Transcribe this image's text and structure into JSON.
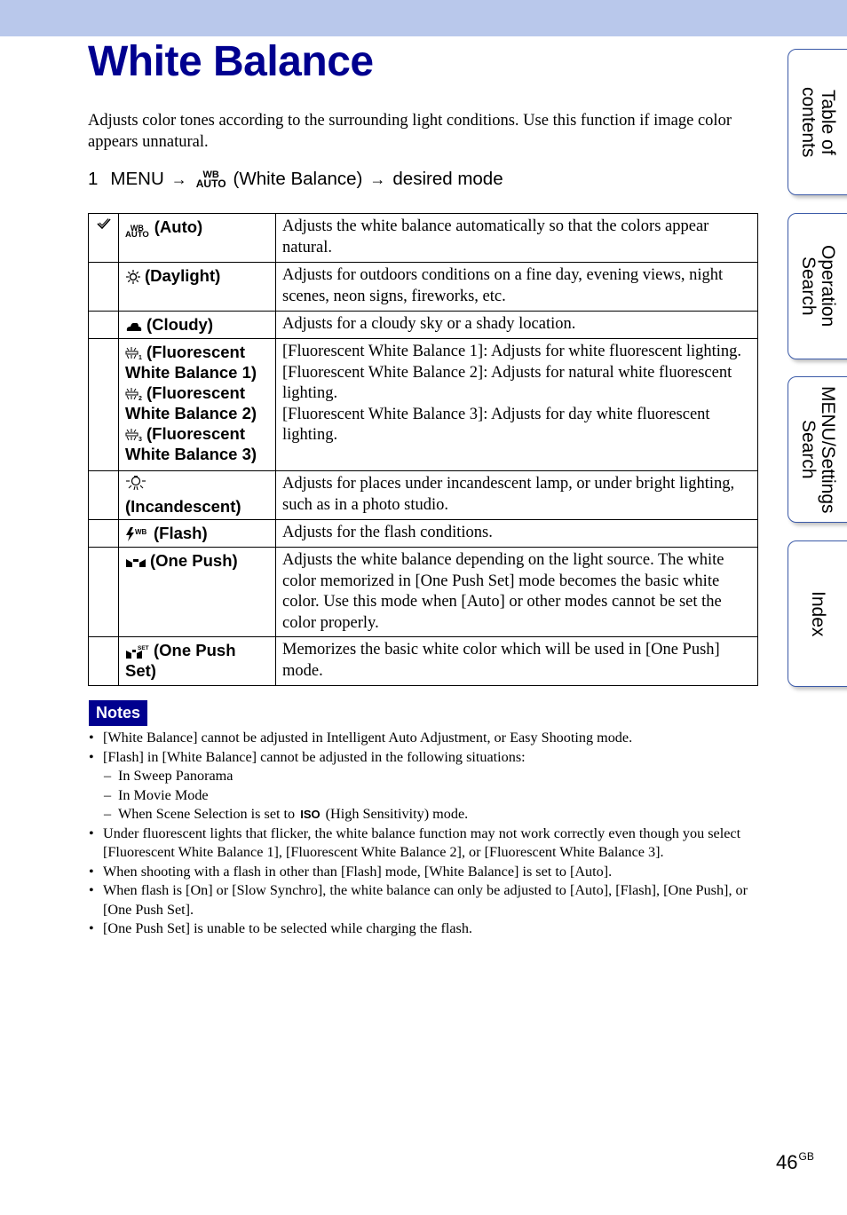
{
  "page": {
    "title": "White Balance",
    "intro": "Adjusts color tones according to the surrounding light conditions. Use this function if image color appears unnatural.",
    "step": {
      "number": "1",
      "menu": "MENU",
      "arrow": "→",
      "icon_top": "WB",
      "icon_bottom": "AUTO",
      "target": "(White Balance)",
      "result": "desired mode"
    }
  },
  "modes": [
    {
      "default": true,
      "check_icon": "✓",
      "icon": "wb-auto",
      "icon_text_top": "WB",
      "icon_text_bottom": "AUTO",
      "label": "(Auto)",
      "description": [
        "Adjusts the white balance automatically so that the colors appear natural."
      ]
    },
    {
      "default": false,
      "icon": "daylight",
      "icon_glyph": "☀",
      "label": "(Daylight)",
      "description": [
        "Adjusts for outdoors conditions on a fine day, evening views, night scenes, neon signs, fireworks, etc."
      ]
    },
    {
      "default": false,
      "icon": "cloudy",
      "icon_glyph": "☁",
      "label": "(Cloudy)",
      "description": [
        "Adjusts for a cloudy sky or a shady location."
      ]
    },
    {
      "default": false,
      "icon": "fluorescent",
      "labels": [
        {
          "icon_glyph": "▤₁",
          "label": "(Fluorescent White Balance 1)"
        },
        {
          "icon_glyph": "▤₂",
          "label": "(Fluorescent White Balance 2)"
        },
        {
          "icon_glyph": "▤₃",
          "label": "(Fluorescent White Balance 3)"
        }
      ],
      "description": [
        "[Fluorescent White Balance 1]: Adjusts for white fluorescent lighting.",
        "[Fluorescent White Balance 2]: Adjusts for natural white fluorescent lighting.",
        "[Fluorescent White Balance 3]: Adjusts for day white fluorescent lighting."
      ]
    },
    {
      "default": false,
      "icon": "incandescent",
      "icon_glyph": "💡",
      "label": "(Incandescent)",
      "description": [
        "Adjusts for places under incandescent lamp, or under bright lighting, such as in a photo studio."
      ]
    },
    {
      "default": false,
      "icon": "flash-wb",
      "icon_glyph": "ϟᵂᴮ",
      "label": "(Flash)",
      "description": [
        "Adjusts for the flash conditions."
      ]
    },
    {
      "default": false,
      "icon": "one-push",
      "icon_glyph": "⬙",
      "label": "(One Push)",
      "description": [
        "Adjusts the white balance depending on the light source. The white color memorized in [One Push Set] mode becomes the basic white color. Use this mode when [Auto] or other modes cannot be set the color properly."
      ]
    },
    {
      "default": false,
      "icon": "one-push-set",
      "icon_glyph": "⬙ˢᴱᵀ",
      "label": "(One Push Set)",
      "description": [
        "Memorizes the basic white color which will be used in [One Push] mode."
      ]
    }
  ],
  "notes": {
    "badge": "Notes",
    "items": [
      {
        "text": "[White Balance] cannot be adjusted in Intelligent Auto Adjustment, or Easy Shooting mode."
      },
      {
        "text": "[Flash] in [White Balance] cannot be adjusted in the following situations:",
        "sub": [
          {
            "text": "In Sweep Panorama"
          },
          {
            "text": "In Movie Mode"
          },
          {
            "before": "When Scene Selection is set to",
            "icon": "ISO",
            "after": "(High Sensitivity) mode."
          }
        ]
      },
      {
        "text": "Under fluorescent lights that flicker, the white balance function may not work correctly even though you select [Fluorescent White Balance 1], [Fluorescent White Balance 2], or [Fluorescent White Balance 3]."
      },
      {
        "text": "When shooting with a flash in other than [Flash] mode, [White Balance] is set to [Auto]."
      },
      {
        "text": "When flash is [On] or [Slow Synchro], the white balance can only be adjusted to [Auto], [Flash], [One Push], or [One Push Set]."
      },
      {
        "text": "[One Push Set] is unable to be selected while charging the flash."
      }
    ]
  },
  "side_tabs": [
    {
      "label": "Table of\ncontents"
    },
    {
      "label": "Operation\nSearch"
    },
    {
      "label": "MENU/Settings\nSearch"
    },
    {
      "label": "Index"
    }
  ],
  "footer": {
    "page_number": "46",
    "suffix": "GB"
  },
  "colors": {
    "title": "#00008f",
    "band": "#b9c8eb",
    "notes_badge": "#00008f",
    "tab_border": "#3b5aa8"
  }
}
